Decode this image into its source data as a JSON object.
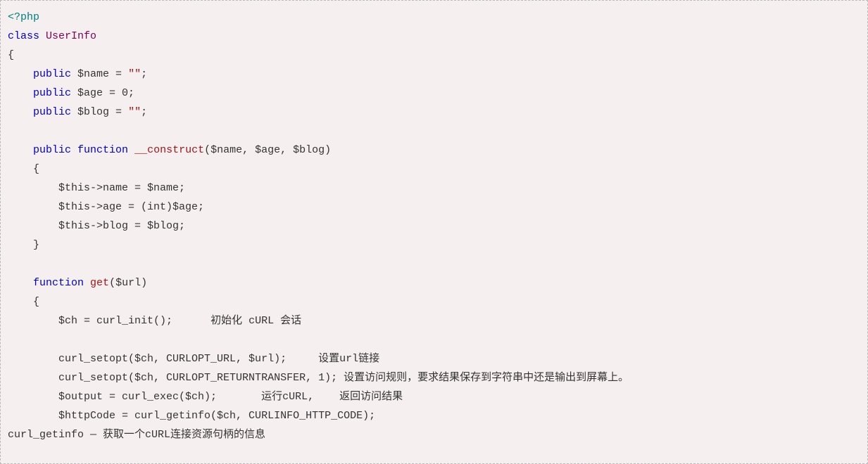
{
  "code": {
    "t_php": "<?php",
    "t_class": "class",
    "t_UserInfo": "UserInfo",
    "t_open1": "{",
    "t_public": "public",
    "l_name": "$name = ",
    "s_empty1": "\"\"",
    "semi": ";",
    "l_age": "$age = 0;",
    "l_blog": "$blog = ",
    "s_empty2": "\"\"",
    "t_function": "function",
    "t_construct": "__construct",
    "t_construct_args": "($name, $age, $blog)",
    "t_open2": "{",
    "l_this_name": "$this->name = $name;",
    "l_this_age": "$this->age = (int)$age;",
    "l_this_blog": "$this->blog = $blog;",
    "t_close2": "}",
    "t_get": "get",
    "t_get_args": "($url)",
    "t_open3": "{",
    "l_ch_init": "$ch = curl_init();",
    "c_ch_init": "初始化 cURL 会话",
    "l_setopt_url": "curl_setopt($ch, CURLOPT_URL, $url);",
    "c_setopt_url": "设置url链接",
    "l_setopt_ret": "curl_setopt($ch, CURLOPT_RETURNTRANSFER, 1);",
    "c_setopt_ret": " 设置访问规则，要求结果保存到字符串中还是输出到屏幕上。",
    "l_output": "$output = curl_exec($ch);",
    "c_output1": "运行cURL,",
    "c_output2": "返回访问结果",
    "l_httpcode": "$httpCode = curl_getinfo($ch, CURLINFO_HTTP_CODE);",
    "l_getinfo_desc": "curl_getinfo — 获取一个cURL连接资源句柄的信息"
  }
}
